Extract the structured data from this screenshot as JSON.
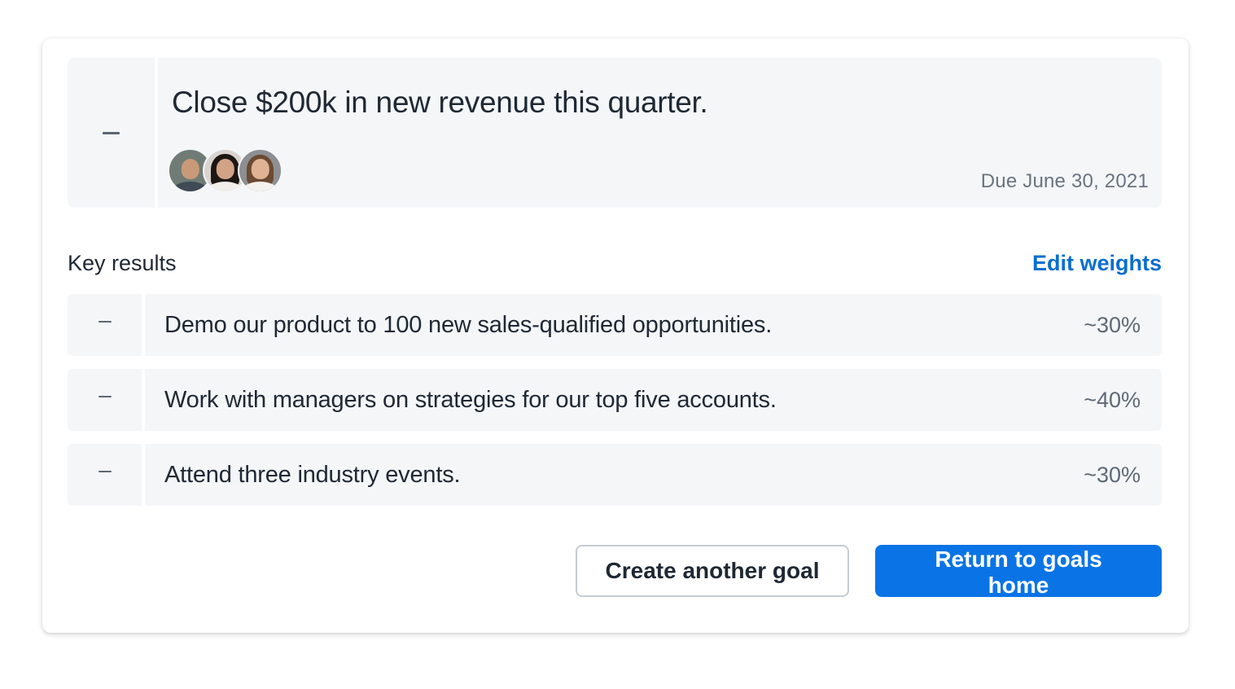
{
  "goal": {
    "title": "Close $200k in new revenue this quarter.",
    "due_date": "Due June 30, 2021",
    "owners": [
      "avatar-person-1",
      "avatar-person-2",
      "avatar-person-3"
    ]
  },
  "key_results": {
    "heading": "Key results",
    "edit_label": "Edit weights",
    "items": [
      {
        "text": "Demo our product to 100 new sales-qualified opportunities.",
        "weight": "~30%"
      },
      {
        "text": "Work with managers on strategies for our top five accounts.",
        "weight": "~40%"
      },
      {
        "text": "Attend three industry events.",
        "weight": "~30%"
      }
    ]
  },
  "actions": {
    "secondary_label": "Create another goal",
    "primary_label": "Return to goals home"
  },
  "colors": {
    "accent": "#0a74e6",
    "link": "#0a6ed1",
    "row_background": "#f4f6f8",
    "muted_text": "#6a7480"
  }
}
